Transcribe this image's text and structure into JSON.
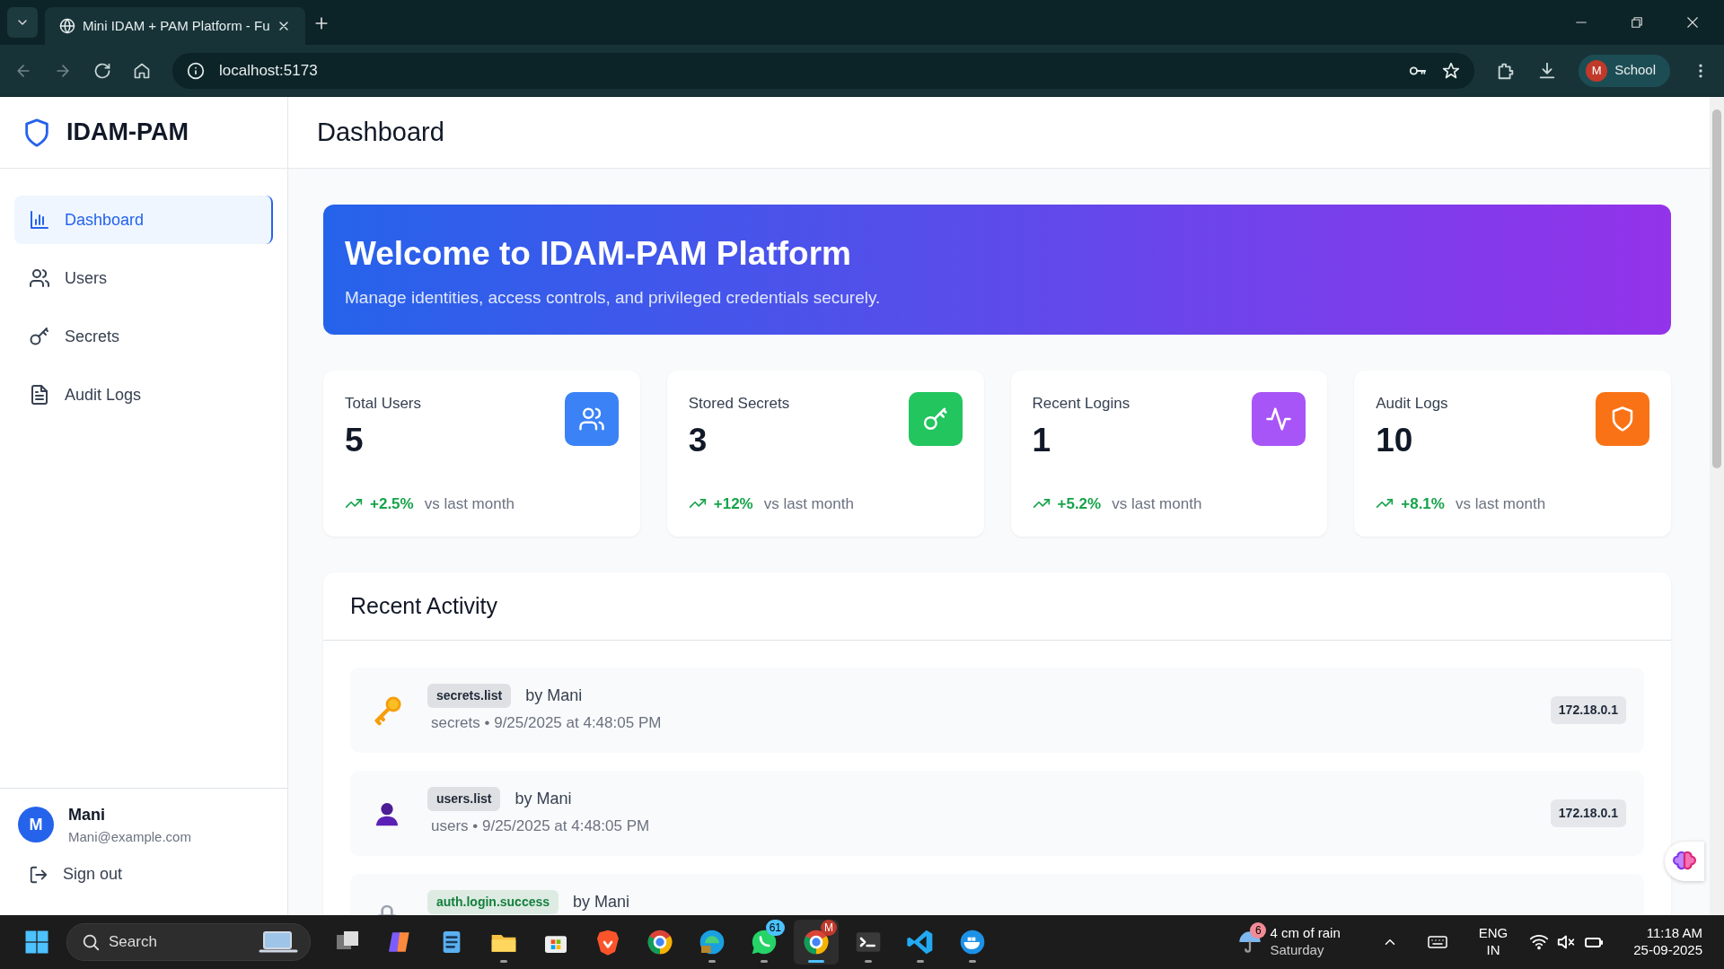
{
  "browser": {
    "tab_title": "Mini IDAM + PAM Platform - Fu",
    "url": "localhost:5173",
    "profile_initial": "M",
    "profile_label": "School"
  },
  "sidebar": {
    "brand": "IDAM-PAM",
    "items": [
      {
        "label": "Dashboard",
        "selected": true
      },
      {
        "label": "Users",
        "selected": false
      },
      {
        "label": "Secrets",
        "selected": false
      },
      {
        "label": "Audit Logs",
        "selected": false
      }
    ],
    "user": {
      "initial": "M",
      "name": "Mani",
      "email": "Mani@example.com"
    },
    "sign_out": "Sign out"
  },
  "header": {
    "title": "Dashboard"
  },
  "banner": {
    "title": "Welcome to IDAM-PAM Platform",
    "subtitle": "Manage identities, access controls, and privileged credentials securely."
  },
  "stats": [
    {
      "label": "Total Users",
      "value": "5",
      "change": "+2.5%",
      "note": "vs last month",
      "color": "#3b82f6"
    },
    {
      "label": "Stored Secrets",
      "value": "3",
      "change": "+12%",
      "note": "vs last month",
      "color": "#22c55e"
    },
    {
      "label": "Recent Logins",
      "value": "1",
      "change": "+5.2%",
      "note": "vs last month",
      "color": "#a855f7"
    },
    {
      "label": "Audit Logs",
      "value": "10",
      "change": "+8.1%",
      "note": "vs last month",
      "color": "#f97316"
    }
  ],
  "activity": {
    "title": "Recent Activity",
    "items": [
      {
        "kind": "key",
        "action": "secrets.list",
        "color": "#1f2937",
        "actor": "by Mani",
        "detail": "secrets • 9/25/2025 at 4:48:05 PM",
        "ip": "172.18.0.1"
      },
      {
        "kind": "person",
        "action": "users.list",
        "color": "#1f2937",
        "actor": "by Mani",
        "detail": "users • 9/25/2025 at 4:48:05 PM",
        "ip": "172.18.0.1"
      },
      {
        "kind": "lock",
        "action": "auth.login.success",
        "color": "#15803d",
        "actor": "by Mani"
      }
    ]
  },
  "taskbar": {
    "search_placeholder": "Search",
    "apps": [
      {
        "kind": "taskview",
        "selected": false
      },
      {
        "kind": "copilot",
        "selected": false
      },
      {
        "kind": "notepad",
        "selected": false
      },
      {
        "kind": "folder",
        "selected": false
      },
      {
        "kind": "store",
        "selected": false
      },
      {
        "kind": "brave",
        "selected": false
      },
      {
        "kind": "chrome",
        "selected": false
      },
      {
        "kind": "edge",
        "selected": false
      },
      {
        "kind": "whatsapp",
        "selected": false,
        "badge": "61"
      },
      {
        "kind": "chrome",
        "selected": true,
        "badge": "M"
      },
      {
        "kind": "terminal",
        "selected": false
      },
      {
        "kind": "vscode",
        "selected": false
      },
      {
        "kind": "docker",
        "selected": false
      }
    ],
    "weather": {
      "badge": "6",
      "text": "4 cm of rain",
      "day": "Saturday"
    },
    "language": "ENG",
    "region": "IN",
    "time": "11:18 AM",
    "date": "25-09-2025"
  }
}
